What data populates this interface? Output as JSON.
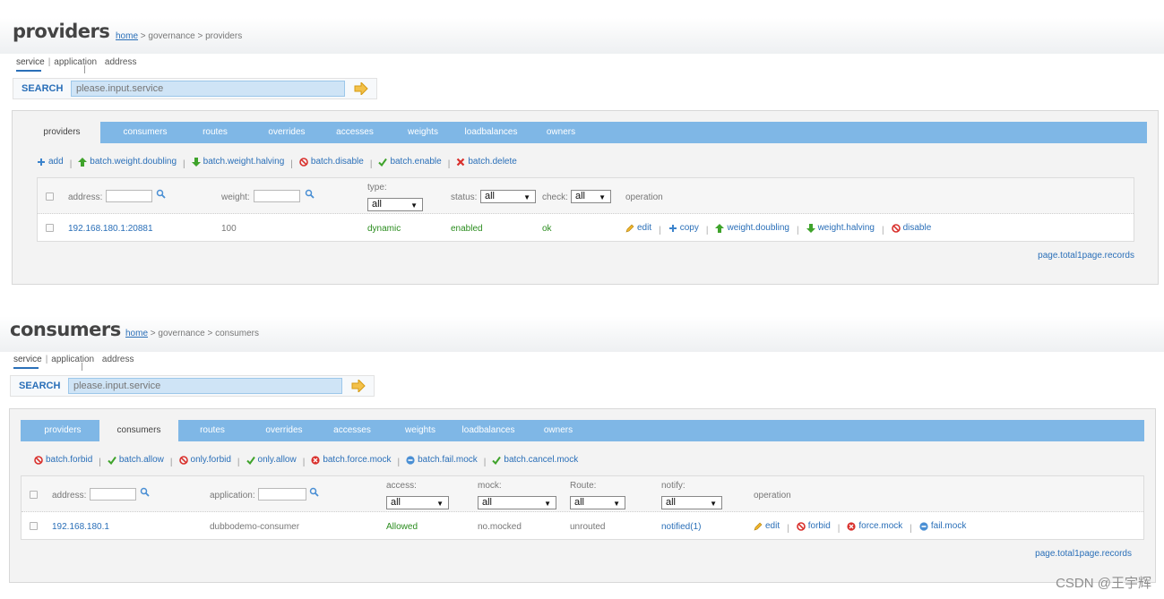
{
  "providers_page": {
    "title": "providers",
    "breadcrumb": {
      "home": "home",
      "rest": " > governance > providers"
    },
    "subnav": {
      "service": "service",
      "application": "application",
      "address": "address"
    },
    "search": {
      "label": "SEARCH",
      "placeholder": "please.input.service"
    },
    "tabs": [
      "providers",
      "consumers",
      "routes",
      "overrides",
      "accesses",
      "weights",
      "loadbalances",
      "owners"
    ],
    "active_tab": "providers",
    "toolbar": {
      "add": "add",
      "batch_weight_doubling": "batch.weight.doubling",
      "batch_weight_halving": "batch.weight.halving",
      "batch_disable": "batch.disable",
      "batch_enable": "batch.enable",
      "batch_delete": "batch.delete"
    },
    "headers": {
      "address": "address:",
      "weight": "weight:",
      "type": "type:",
      "type_select": "all",
      "status": "status:",
      "status_select": "all",
      "check": "check:",
      "check_select": "all",
      "operation": "operation"
    },
    "row": {
      "address": "192.168.180.1:20881",
      "weight": "100",
      "type": "dynamic",
      "status": "enabled",
      "check": "ok",
      "ops": {
        "edit": "edit",
        "copy": "copy",
        "weight_doubling": "weight.doubling",
        "weight_halving": "weight.halving",
        "disable": "disable"
      }
    },
    "footer": "page.total1page.records"
  },
  "consumers_page": {
    "title": "consumers",
    "breadcrumb": {
      "home": "home",
      "rest": " > governance > consumers"
    },
    "subnav": {
      "service": "service",
      "application": "application",
      "address": "address"
    },
    "search": {
      "label": "SEARCH",
      "placeholder": "please.input.service"
    },
    "tabs": [
      "providers",
      "consumers",
      "routes",
      "overrides",
      "accesses",
      "weights",
      "loadbalances",
      "owners"
    ],
    "active_tab": "consumers",
    "toolbar": {
      "batch_forbid": "batch.forbid",
      "batch_allow": "batch.allow",
      "only_forbid": "only.forbid",
      "only_allow": "only.allow",
      "batch_force_mock": "batch.force.mock",
      "batch_fail_mock": "batch.fail.mock",
      "batch_cancel_mock": "batch.cancel.mock"
    },
    "headers": {
      "address": "address:",
      "application": "application:",
      "access": "access:",
      "access_select": "all",
      "mock": "mock:",
      "mock_select": "all",
      "route": "Route:",
      "route_select": "all",
      "notify": "notify:",
      "notify_select": "all",
      "operation": "operation"
    },
    "row": {
      "address": "192.168.180.1",
      "application": "dubbodemo-consumer",
      "access": "Allowed",
      "mock": "no.mocked",
      "route": "unrouted",
      "notify": "notified(1)",
      "ops": {
        "edit": "edit",
        "forbid": "forbid",
        "force_mock": "force.mock",
        "fail_mock": "fail.mock"
      }
    },
    "footer": "page.total1page.records"
  },
  "watermark": "CSDN @王宇辉",
  "colors": {
    "tab_bar": "#7fb7e6",
    "link": "#2a6fb8",
    "ok_green": "#2a8c1e",
    "search_fill": "#cfe4f6"
  }
}
